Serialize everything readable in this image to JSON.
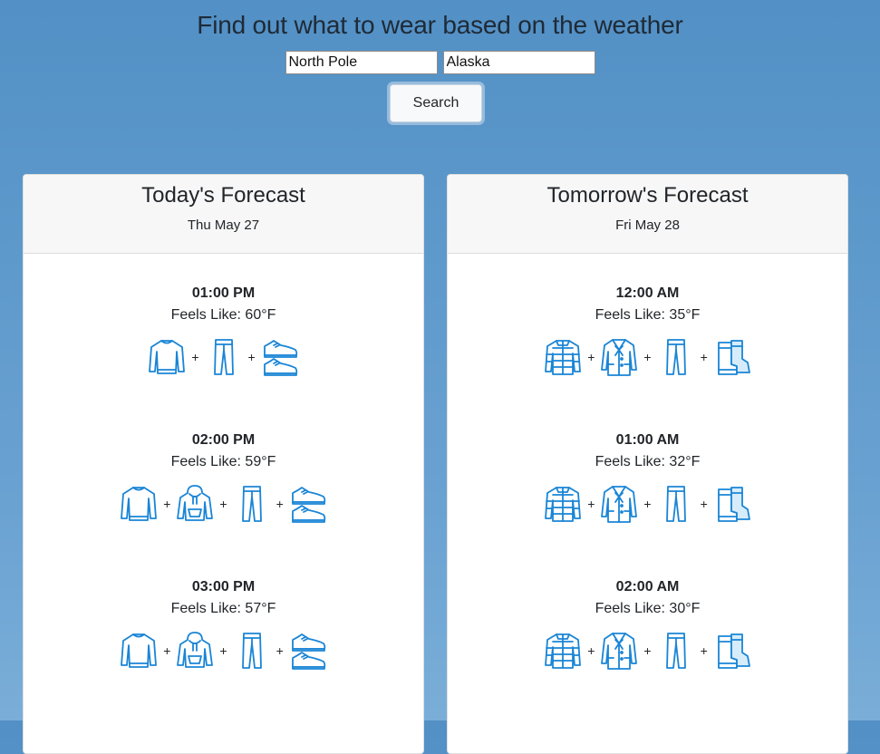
{
  "header": {
    "title": "Find out what to wear based on the weather",
    "city_value": "North Pole",
    "region_value": "Alaska",
    "search_label": "Search"
  },
  "today": {
    "title": "Today's Forecast",
    "date": "Thu May 27",
    "slots": [
      {
        "time": "01:00 PM",
        "feels": "Feels Like: 60°F",
        "items": [
          "sweater-icon",
          "pants-icon",
          "sneakers-icon"
        ]
      },
      {
        "time": "02:00 PM",
        "feels": "Feels Like: 59°F",
        "items": [
          "sweater-icon",
          "hoodie-icon",
          "pants-icon",
          "sneakers-icon"
        ]
      },
      {
        "time": "03:00 PM",
        "feels": "Feels Like: 57°F",
        "items": [
          "sweater-icon",
          "hoodie-icon",
          "pants-icon",
          "sneakers-icon"
        ]
      }
    ]
  },
  "tomorrow": {
    "title": "Tomorrow's Forecast",
    "date": "Fri May 28",
    "slots": [
      {
        "time": "12:00 AM",
        "feels": "Feels Like: 35°F",
        "items": [
          "puffer-jacket-icon",
          "coat-icon",
          "pants-icon",
          "boots-icon"
        ]
      },
      {
        "time": "01:00 AM",
        "feels": "Feels Like: 32°F",
        "items": [
          "puffer-jacket-icon",
          "coat-icon",
          "pants-icon",
          "boots-icon"
        ]
      },
      {
        "time": "02:00 AM",
        "feels": "Feels Like: 30°F",
        "items": [
          "puffer-jacket-icon",
          "coat-icon",
          "pants-icon",
          "boots-icon"
        ]
      }
    ]
  },
  "colors": {
    "accent": "#1a85d6",
    "icon_fill": "#d7ecfb"
  }
}
